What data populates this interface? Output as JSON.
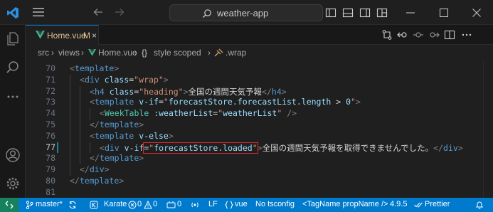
{
  "window": {
    "search_text": "weather-app"
  },
  "colors": {
    "accent": "#007acc",
    "remote": "#16825d",
    "modified": "#e2c08d",
    "vue_icon": "#41b883",
    "highlight": "#e0282e"
  },
  "tab": {
    "name": "Home.vue",
    "modified": "M",
    "close": "×"
  },
  "breadcrumb": {
    "items": [
      "src",
      "views",
      "Home.vue",
      "style scoped",
      ".wrap"
    ],
    "symbol": "{}"
  },
  "code": {
    "active_line": "77",
    "lines": [
      {
        "n": "70",
        "t": [
          [
            "tag",
            "<"
          ],
          [
            "name",
            "template"
          ],
          [
            "tag",
            ">"
          ]
        ]
      },
      {
        "n": "71",
        "t": [
          [
            "tag",
            "<"
          ],
          [
            "name",
            "div"
          ],
          [
            "txt",
            " "
          ],
          [
            "attr",
            "class"
          ],
          [
            "txt",
            "="
          ],
          [
            "str",
            "\"wrap\""
          ],
          [
            "tag",
            ">"
          ]
        ]
      },
      {
        "n": "72",
        "t": [
          [
            "tag",
            "<"
          ],
          [
            "name",
            "h4"
          ],
          [
            "txt",
            " "
          ],
          [
            "attr",
            "class"
          ],
          [
            "txt",
            "="
          ],
          [
            "str",
            "\"heading\""
          ],
          [
            "tag",
            ">"
          ],
          [
            "txt",
            "全国の週間天気予報"
          ],
          [
            "tag",
            "</"
          ],
          [
            "name",
            "h4"
          ],
          [
            "tag",
            ">"
          ]
        ]
      },
      {
        "n": "73",
        "t": [
          [
            "tag",
            "<"
          ],
          [
            "name",
            "template"
          ],
          [
            "txt",
            " "
          ],
          [
            "attr",
            "v-if"
          ],
          [
            "txt",
            "="
          ],
          [
            "str",
            "\""
          ],
          [
            "attr",
            "forecastStore.forecastList.length"
          ],
          [
            "txt",
            " > "
          ],
          [
            "attr",
            "0"
          ],
          [
            "str",
            "\""
          ],
          [
            "tag",
            ">"
          ]
        ]
      },
      {
        "n": "74",
        "t": [
          [
            "tag",
            "<"
          ],
          [
            "comp",
            "WeekTable"
          ],
          [
            "txt",
            " "
          ],
          [
            "attr",
            ":weatherList"
          ],
          [
            "txt",
            "="
          ],
          [
            "str",
            "\""
          ],
          [
            "attr",
            "weatherList"
          ],
          [
            "str",
            "\""
          ],
          [
            "txt",
            " "
          ],
          [
            "tag",
            "/>"
          ]
        ]
      },
      {
        "n": "75",
        "t": [
          [
            "tag",
            "</"
          ],
          [
            "name",
            "template"
          ],
          [
            "tag",
            ">"
          ]
        ]
      },
      {
        "n": "76",
        "t": [
          [
            "tag",
            "<"
          ],
          [
            "name",
            "template"
          ],
          [
            "txt",
            " "
          ],
          [
            "attr",
            "v-else"
          ],
          [
            "tag",
            ">"
          ]
        ]
      },
      {
        "n": "77",
        "t": [
          [
            "tag",
            "<"
          ],
          [
            "name",
            "div"
          ],
          [
            "txt",
            " "
          ],
          [
            "attr",
            "v-if"
          ],
          [
            "txt",
            "="
          ],
          [
            "str",
            "\""
          ],
          [
            "attr",
            "forecastStore.loaded"
          ],
          [
            "str",
            "\""
          ],
          [
            "tag",
            ">"
          ],
          [
            "txt",
            "全国の週間天気予報を取得できませんでした。"
          ],
          [
            "tag",
            "</"
          ],
          [
            "name",
            "div"
          ],
          [
            "tag",
            ">"
          ]
        ]
      },
      {
        "n": "78",
        "t": [
          [
            "tag",
            "</"
          ],
          [
            "name",
            "template"
          ],
          [
            "tag",
            ">"
          ]
        ]
      },
      {
        "n": "79",
        "t": [
          [
            "tag",
            "</"
          ],
          [
            "name",
            "div"
          ],
          [
            "tag",
            ">"
          ]
        ]
      },
      {
        "n": "80",
        "t": [
          [
            "tag",
            "</"
          ],
          [
            "name",
            "template"
          ],
          [
            "tag",
            ">"
          ]
        ]
      },
      {
        "n": "81",
        "t": []
      }
    ]
  },
  "statusbar": {
    "remote_icon": "remote-icon",
    "branch": "master*",
    "sync_icon": "sync-icon",
    "karate": "Karate",
    "errors": "0",
    "warnings": "0",
    "ports": "0",
    "eol": "LF",
    "language": "vue",
    "tsconfig": "No tsconfig",
    "tag_name": "<TagName propName />",
    "version": "4.9.5",
    "prettier": "Prettier"
  }
}
